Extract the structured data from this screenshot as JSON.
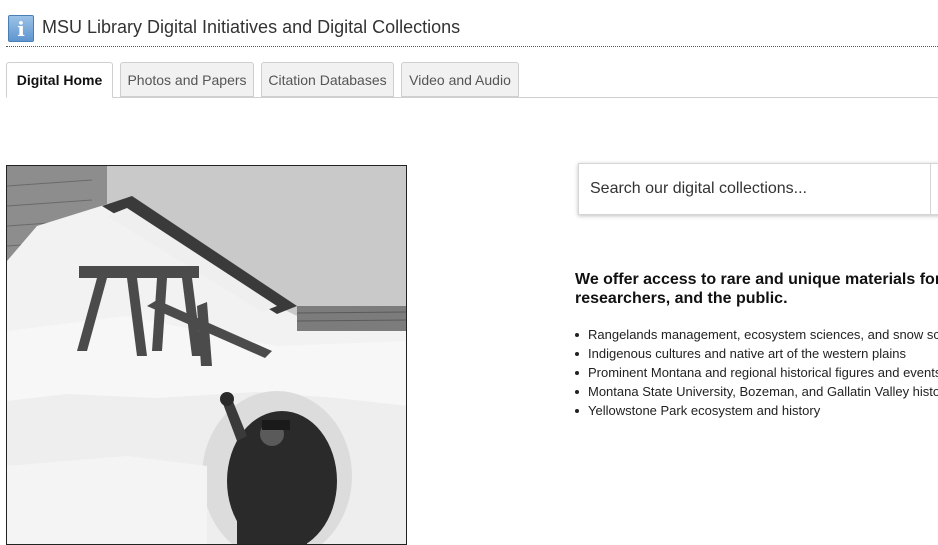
{
  "header": {
    "icon": "info-icon",
    "icon_glyph": "i",
    "title": "MSU Library Digital Initiatives and Digital Collections"
  },
  "tabs": [
    {
      "label": "Digital Home",
      "active": true
    },
    {
      "label": "Photos and Papers",
      "active": false
    },
    {
      "label": "Citation Databases",
      "active": false
    },
    {
      "label": "Video and Audio",
      "active": false
    }
  ],
  "photo": {
    "subject": "black-and-white photo of a man waving from a snow tunnel beside a buried building"
  },
  "search": {
    "placeholder": "Search our digital collections..."
  },
  "main": {
    "lead_line1": "We offer access to rare and unique materials for",
    "lead_line2": "researchers, and the public.",
    "features": [
      "Rangelands management, ecosystem sciences, and snow sc",
      "Indigenous cultures and native art of the western plains",
      "Prominent Montana and regional historical figures and events",
      "Montana State University, Bozeman, and Gallatin Valley history",
      "Yellowstone Park ecosystem and history"
    ]
  }
}
